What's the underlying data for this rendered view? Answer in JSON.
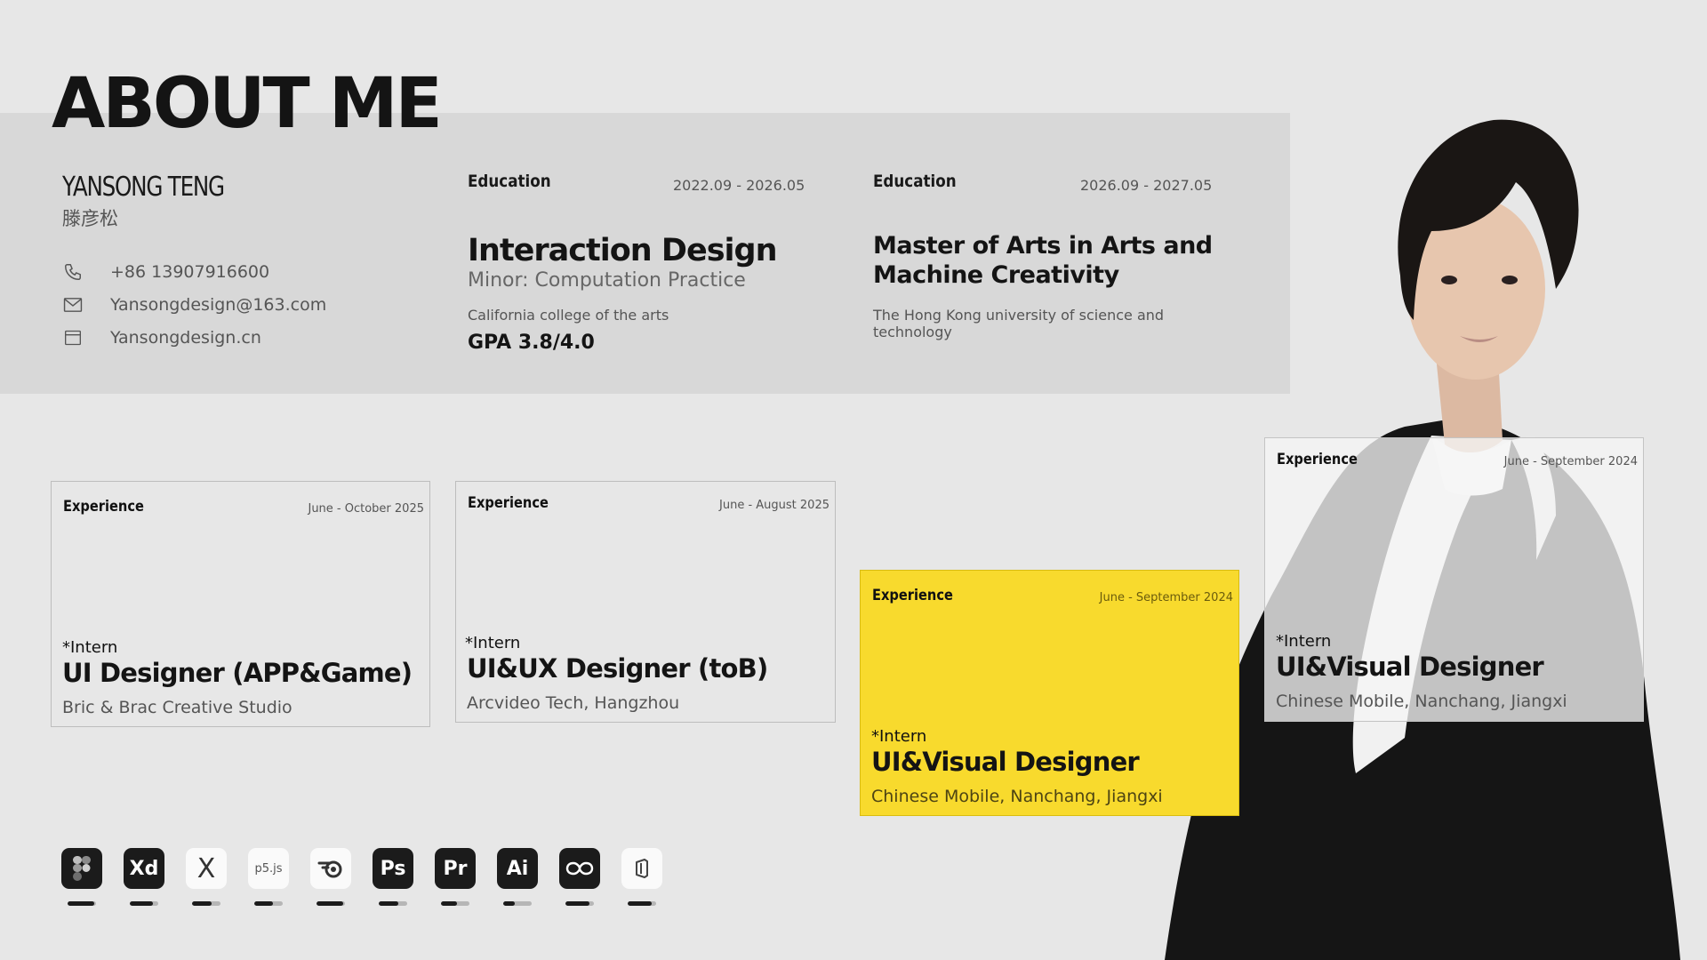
{
  "header": {
    "title": "ABOUT ME"
  },
  "profile": {
    "name": "YANSONG TENG",
    "name_cn": "滕彦松",
    "phone": "+86 13907916600",
    "email": "Yansongdesign@163.com",
    "website": "Yansongdesign.cn"
  },
  "education": [
    {
      "label": "Education",
      "date": "2022.09 - 2026.05",
      "major": "Interaction Design",
      "minor": "Minor: Computation Practice",
      "school": "California college of the arts",
      "gpa": "GPA 3.8/4.0"
    },
    {
      "label": "Education",
      "date": "2026.09 - 2027.05",
      "major": "Master of Arts in Arts and Machine Creativity",
      "school": "The Hong Kong university of science and technology"
    }
  ],
  "experience": [
    {
      "label": "Experience",
      "date": "June - October 2025",
      "intern": "*Intern",
      "role": "UI Designer (APP&Game)",
      "company": "Bric & Brac Creative Studio"
    },
    {
      "label": "Experience",
      "date": "June - August 2025",
      "intern": "*Intern",
      "role": "UI&UX Designer (toB)",
      "company": "Arcvideo Tech, Hangzhou"
    },
    {
      "label": "Experience",
      "date": "June - September 2024",
      "intern": "*Intern",
      "role": "UI&Visual Designer",
      "company": "Chinese Mobile, Nanchang, Jiangxi"
    },
    {
      "label": "Experience",
      "date": "June - September 2024",
      "intern": "*Intern",
      "role": "UI&Visual Designer",
      "company": "Chinese Mobile, Nanchang, Jiangxi"
    }
  ],
  "tools": [
    {
      "icon": "figma-icon",
      "text": "",
      "level": 0.95
    },
    {
      "icon": "adobe-xd-icon",
      "text": "Xd",
      "level": 0.8
    },
    {
      "icon": "framer-icon",
      "text": "X",
      "level": 0.7
    },
    {
      "icon": "p5js-icon",
      "text": "p5.js",
      "level": 0.65
    },
    {
      "icon": "blender-icon",
      "text": "",
      "level": 0.95
    },
    {
      "icon": "photoshop-icon",
      "text": "Ps",
      "level": 0.7
    },
    {
      "icon": "premiere-icon",
      "text": "Pr",
      "level": 0.55
    },
    {
      "icon": "illustrator-icon",
      "text": "Ai",
      "level": 0.4
    },
    {
      "icon": "infinity-icon",
      "text": "",
      "level": 0.85
    },
    {
      "icon": "office-icon",
      "text": "",
      "level": 0.85
    }
  ],
  "colors": {
    "accent_yellow": "#f8da2d",
    "dark": "#1b1b1b",
    "background": "#e7e7e7",
    "band": "#d8d8d8"
  }
}
